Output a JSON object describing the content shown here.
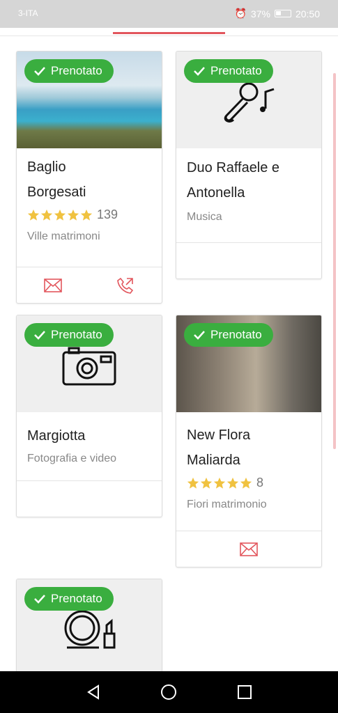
{
  "status": {
    "carrier": "3-ITA",
    "alarm_icon": "alarm-icon",
    "battery": "37%",
    "time": "20:50"
  },
  "badge_label": "Prenotato",
  "cards": [
    {
      "title_line1": "Baglio",
      "title_line2": "Borgesati",
      "rating_count": "139",
      "category": "Ville matrimoni"
    },
    {
      "title_line1": "Duo Raffaele e",
      "title_line2": "Antonella",
      "category": "Musica"
    },
    {
      "title_line1": "Margiotta",
      "category": "Fotografia e video"
    },
    {
      "title_line1": "New Flora",
      "title_line2": "Maliarda",
      "rating_count": "8",
      "category": "Fiori matrimonio"
    },
    {
      "title_line1": ""
    }
  ],
  "colors": {
    "accent": "#e2565d",
    "badge": "#3aae3f",
    "star": "#f0c240"
  }
}
